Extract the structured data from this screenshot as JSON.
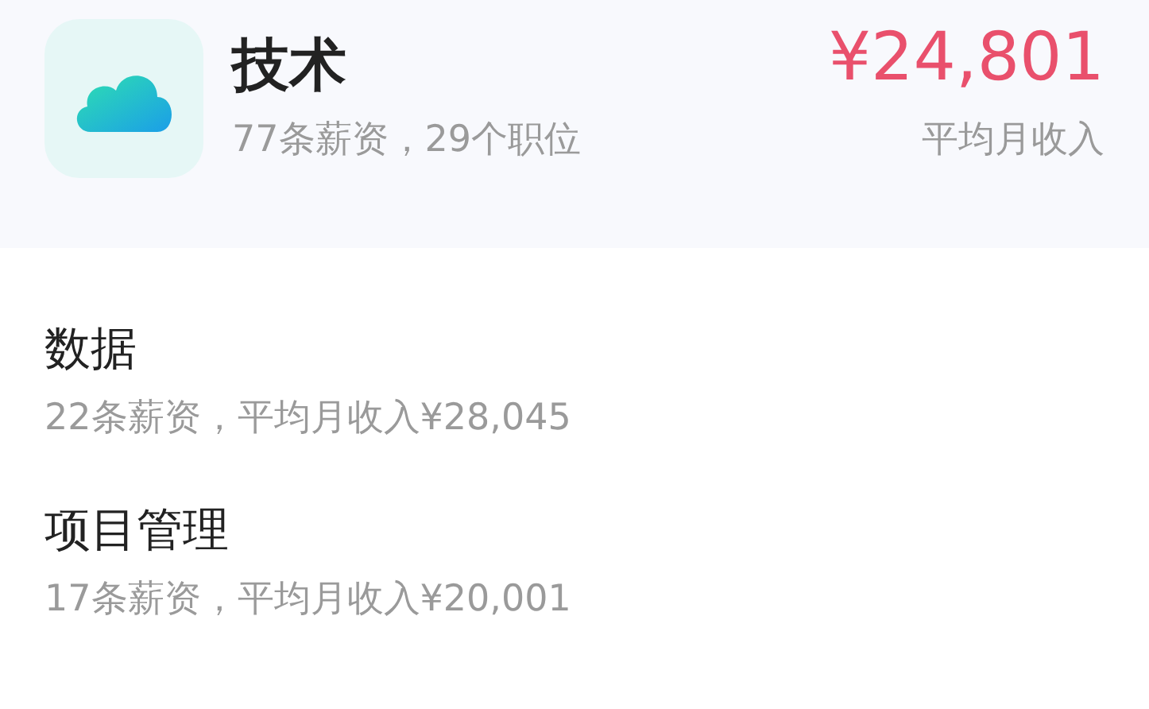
{
  "header": {
    "title": "技术",
    "subtitle": "77条薪资，29个职位",
    "amount": "¥24,801",
    "amount_label": "平均月收入"
  },
  "categories": [
    {
      "name": "数据",
      "summary": "22条薪资，平均月收入¥28,045"
    },
    {
      "name": "项目管理",
      "summary": "17条薪资，平均月收入¥20,001"
    }
  ]
}
